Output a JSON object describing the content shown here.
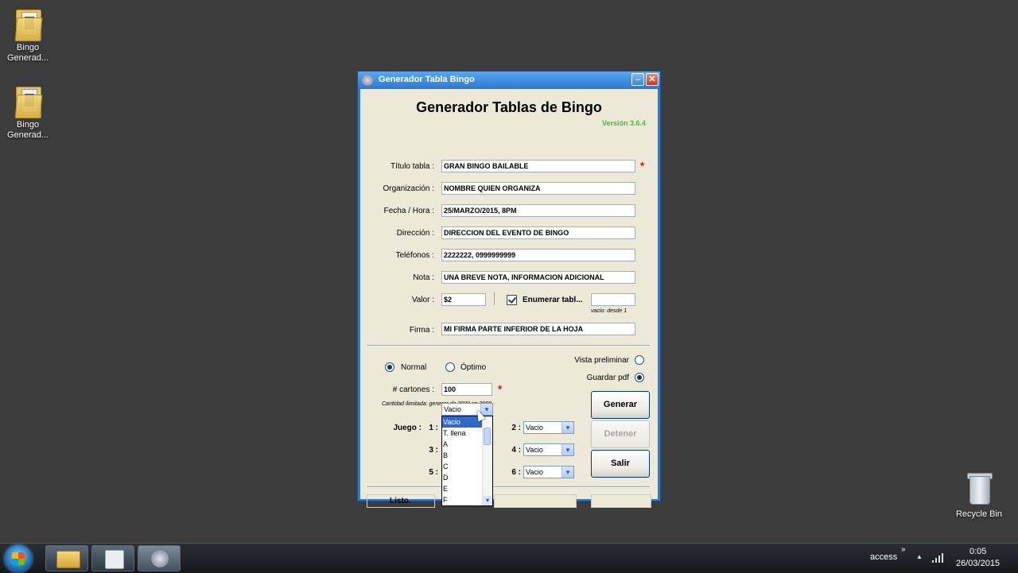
{
  "desktop": {
    "icons": [
      {
        "label": "Bingo Generad...",
        "name": "bingo-folder-1"
      },
      {
        "label": "Bingo Generad...",
        "name": "bingo-folder-2"
      }
    ],
    "recycle_label": "Recycle Bin"
  },
  "window": {
    "title": "Generador Tabla Bingo",
    "min_glyph": "–",
    "close_glyph": "✕"
  },
  "app": {
    "heading": "Generador Tablas de Bingo",
    "version": "Versión 3.6.4",
    "required_mark": "*",
    "fields": {
      "titulo": {
        "label": "Título tabla :",
        "value": "GRAN BINGO BAILABLE"
      },
      "organizacion": {
        "label": "Organización :",
        "value": "NOMBRE QUIEN ORGANIZA"
      },
      "fecha": {
        "label": "Fecha / Hora :",
        "value": "25/MARZO/2015, 8PM"
      },
      "direccion": {
        "label": "Dirección :",
        "value": "DIRECCION DEL EVENTO DE BINGO"
      },
      "telefonos": {
        "label": "Teléfonos :",
        "value": "2222222, 0999999999"
      },
      "nota": {
        "label": "Nota :",
        "value": "UNA BREVE NOTA, INFORMACION ADICIONAL"
      },
      "valor": {
        "label": "Valor :",
        "value": "$2"
      },
      "enumerar": {
        "label": "Enumerar tabl...",
        "value": "",
        "checked": true,
        "hint": "vacio: desde 1"
      },
      "firma": {
        "label": "Firma :",
        "value": "MI FIRMA PARTE INFERIOR DE LA HOJA"
      }
    },
    "mode": {
      "normal": "Normal",
      "optimo": "Óptimo",
      "selected": "Normal"
    },
    "output": {
      "vista": "Vista preliminar",
      "guardar": "Guardar pdf",
      "selected": "Guardar pdf"
    },
    "cartones": {
      "label": "# cartones :",
      "value": "100",
      "hint": "Cantidad ilimitada: generar de 3000 en 3000."
    },
    "juego": {
      "label": "Juego :",
      "slots": [
        {
          "num": "1 :",
          "value": "Vacio"
        },
        {
          "num": "2 :",
          "value": "Vacio"
        },
        {
          "num": "3 :",
          "value": ""
        },
        {
          "num": "4 :",
          "value": "Vacio"
        },
        {
          "num": "5 :",
          "value": ""
        },
        {
          "num": "6 :",
          "value": "Vacio"
        }
      ],
      "arrow": "▾",
      "dropdown_options": [
        "Vacio",
        "T. llena",
        "A",
        "B",
        "C",
        "D",
        "E",
        "F"
      ],
      "dropdown_selected": "Vacio"
    },
    "buttons": {
      "generar": "Generar",
      "detener": "Detener",
      "salir": "Salir"
    },
    "status": "Listo."
  },
  "taskbar": {
    "tray_label": "access",
    "tray_chevron": "»",
    "tray_up": "▲",
    "time": "0:05",
    "date": "26/03/2015"
  },
  "colors": {
    "desktop": "#3c3c3c",
    "window_frame": "#2a7bd4",
    "client": "#ece9d8",
    "version_green": "#3bbf3b",
    "required_red": "#e00000",
    "selection_blue": "#316ac5"
  }
}
